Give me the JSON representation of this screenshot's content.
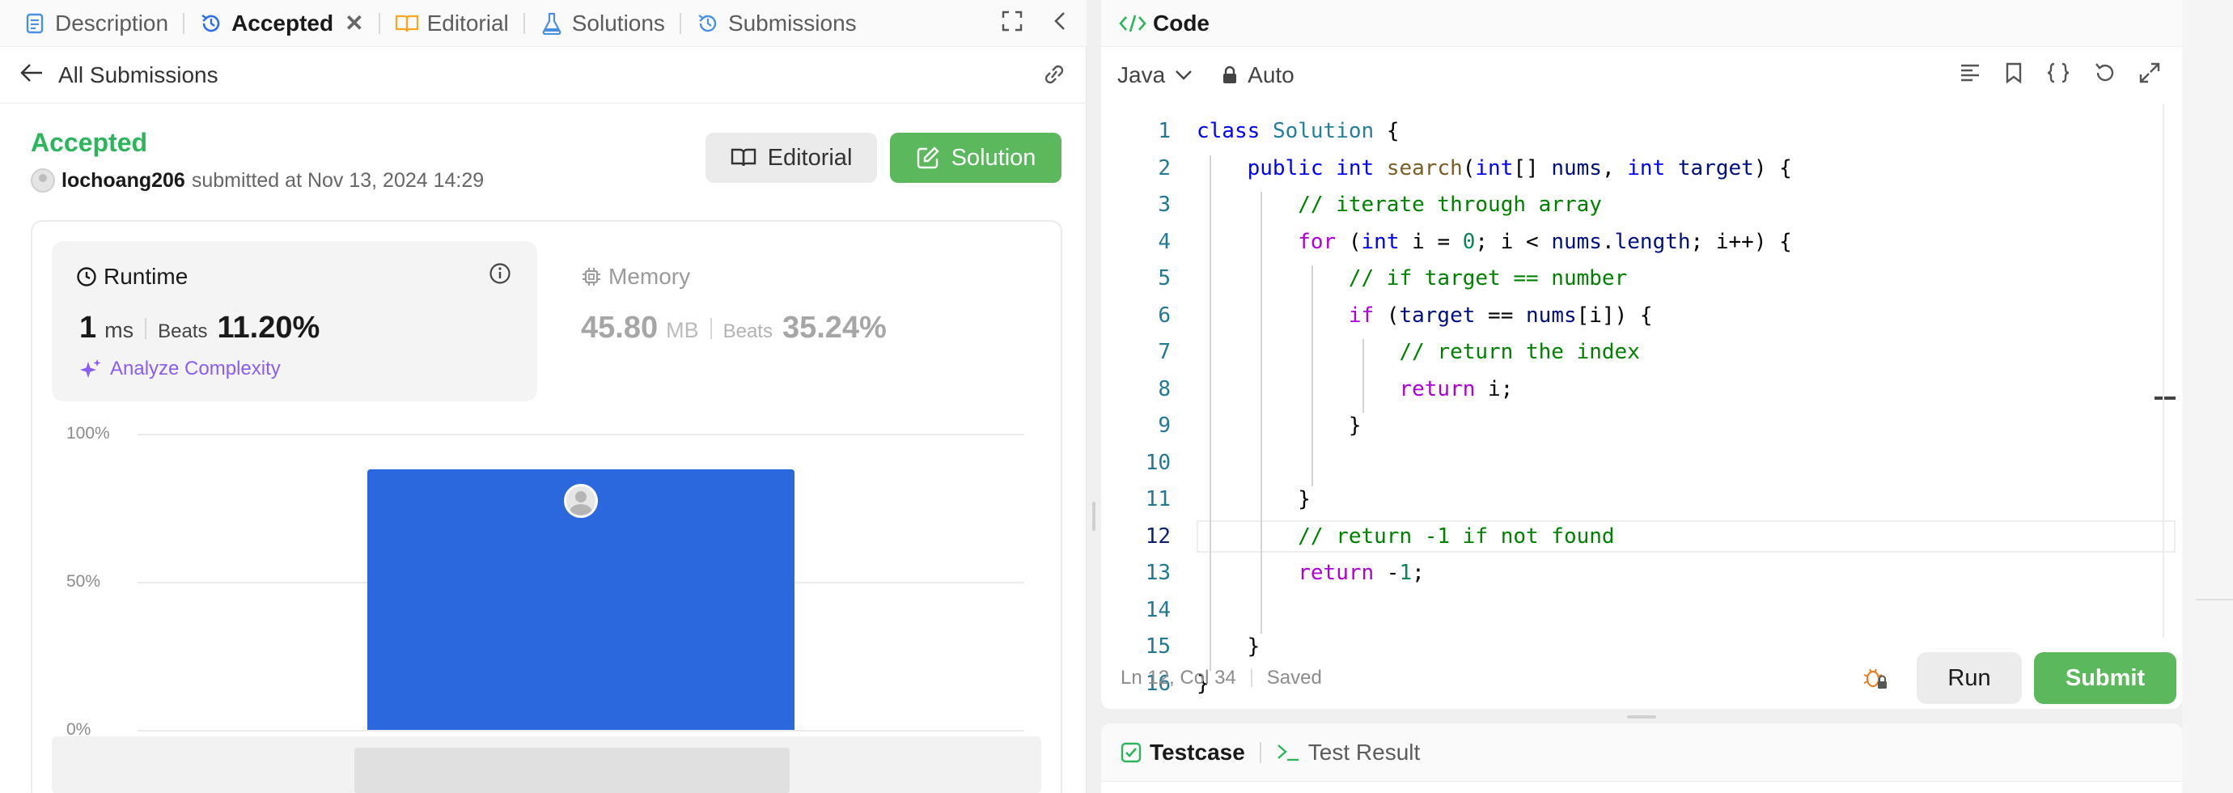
{
  "left_tabs": [
    {
      "label": "Description"
    },
    {
      "label": "Accepted"
    },
    {
      "label": "Editorial"
    },
    {
      "label": "Solutions"
    },
    {
      "label": "Submissions"
    }
  ],
  "subbar": {
    "back_label": "All Submissions"
  },
  "submission": {
    "status": "Accepted",
    "username": "lochoang206",
    "submitted_text": "submitted at Nov 13, 2024 14:29"
  },
  "buttons": {
    "editorial": "Editorial",
    "solution": "Solution"
  },
  "runtime": {
    "title": "Runtime",
    "value": "1",
    "unit": "ms",
    "beats_label": "Beats",
    "beats": "11.20%",
    "analyze": "Analyze Complexity"
  },
  "memory": {
    "title": "Memory",
    "value": "45.80",
    "unit": "MB",
    "beats_label": "Beats",
    "beats": "35.24%"
  },
  "chart_data": {
    "type": "bar",
    "categories": [
      ""
    ],
    "values": [
      88
    ],
    "yticks": [
      "100%",
      "50%",
      "0%"
    ],
    "ylim": [
      0,
      100
    ],
    "color": "#2b68dd",
    "grid": true
  },
  "code_panel": {
    "title": "Code",
    "language": "Java",
    "mode": "Auto",
    "status_pos": "Ln 12, Col 34",
    "status_saved": "Saved",
    "run": "Run",
    "submit": "Submit"
  },
  "code_lines": [
    "class Solution {",
    "    public int search(int[] nums, int target) {",
    "        // iterate through array",
    "        for (int i = 0; i < nums.length; i++) {",
    "            // if target == number",
    "            if (target == nums[i]) {",
    "                // return the index",
    "                return i;",
    "            }",
    "",
    "        }",
    "        // return -1 if not found",
    "        return -1;",
    "",
    "    }",
    "}"
  ],
  "bottom_tabs": [
    {
      "label": "Testcase"
    },
    {
      "label": "Test Result"
    }
  ]
}
